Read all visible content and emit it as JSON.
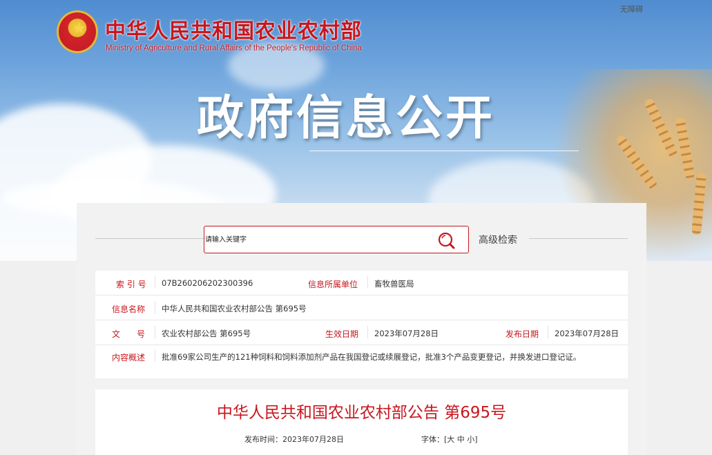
{
  "header": {
    "ministry_cn": "中华人民共和国农业农村部",
    "ministry_en": "Ministry of Agriculture and Rural Affairs of the People's Republic of China",
    "accessibility": "无障碍",
    "hero_title": "政府信息公开"
  },
  "search": {
    "placeholder": "请输入关键字",
    "button_icon": "search-icon",
    "advanced_label": "高级检索"
  },
  "info": {
    "index_label": "索 引 号",
    "index_value": "07B260206202300396",
    "dept_label": "信息所属单位",
    "dept_value": "畜牧兽医局",
    "name_label": "信息名称",
    "name_value": "中华人民共和国农业农村部公告 第695号",
    "docno_label": "文　　号",
    "docno_value": "农业农村部公告 第695号",
    "effective_label": "生效日期",
    "effective_value": "2023年07月28日",
    "publish_label": "发布日期",
    "publish_value": "2023年07月28日",
    "summary_label": "内容概述",
    "summary_value": "批准69家公司生产的121种饲料和饲料添加剂产品在我国登记或续展登记，批准3个产品变更登记，并换发进口登记证。"
  },
  "article": {
    "title": "中华人民共和国农业农村部公告 第695号",
    "publish_time_label": "发布时间：",
    "publish_time_value": "2023年07月28日",
    "font_label": "字体：",
    "font_open": "[",
    "font_large": "大",
    "font_medium": "中",
    "font_small": "小",
    "font_close": "]"
  },
  "colors": {
    "brand_red": "#c8161d",
    "sky_blue": "#6ea4dc"
  }
}
